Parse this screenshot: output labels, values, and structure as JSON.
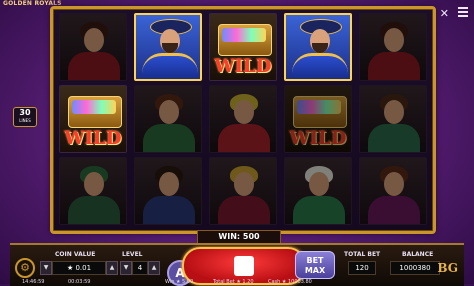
{
  "game": {
    "title": "GOLDEN ROYALS",
    "close_glyph": "✕",
    "lines": {
      "count": "30",
      "label": "LINES"
    }
  },
  "reels": [
    {
      "cells": [
        {
          "type": "queen",
          "dim": true,
          "hair": "#3a1a12",
          "robe": "#8a1a20"
        },
        {
          "type": "wild",
          "dim": false,
          "label": "WILD"
        },
        {
          "type": "jester",
          "dim": true,
          "hair": "#2a6a3a",
          "robe": "#2a5a3a"
        }
      ]
    },
    {
      "cells": [
        {
          "type": "king",
          "dim": false
        },
        {
          "type": "queen",
          "dim": true,
          "hair": "#5a2a18",
          "robe": "#2a6a3a"
        },
        {
          "type": "prince",
          "dim": true,
          "hair": "#2a1a10",
          "robe": "#2a3a7a"
        }
      ]
    },
    {
      "cells": [
        {
          "type": "wild",
          "dim": false,
          "label": "WILD"
        },
        {
          "type": "queen",
          "dim": true,
          "hair": "#c8b030",
          "robe": "#a8222a"
        },
        {
          "type": "queen",
          "dim": true,
          "hair": "#c8a030",
          "robe": "#7a1a30"
        }
      ]
    },
    {
      "cells": [
        {
          "type": "king",
          "dim": false
        },
        {
          "type": "wild",
          "dim": true,
          "label": "WILD"
        },
        {
          "type": "elder",
          "dim": true,
          "hair": "#e8e8e0",
          "robe": "#2a7a4a"
        }
      ]
    },
    {
      "cells": [
        {
          "type": "queen",
          "dim": true,
          "hair": "#3a1a12",
          "robe": "#8a1a20"
        },
        {
          "type": "queen",
          "dim": true,
          "hair": "#4a2a18",
          "robe": "#2a6a4a"
        },
        {
          "type": "queen",
          "dim": true,
          "hair": "#5a2a18",
          "robe": "#6a1a5a"
        }
      ]
    }
  ],
  "win": {
    "label": "WIN:",
    "value": "500"
  },
  "controls": {
    "coin_value": {
      "label": "COIN VALUE",
      "value": "★ 0.01"
    },
    "level": {
      "label": "LEVEL",
      "value": "4"
    },
    "auto_label": "A",
    "bet_max": {
      "line1": "BET",
      "line2": "MAX"
    },
    "total_bet": {
      "label": "TOTAL BET",
      "value": "120"
    },
    "balance": {
      "label": "BALANCE",
      "value": "1000380"
    },
    "settings_glyph": "⚙",
    "brand": "BG"
  },
  "footer": {
    "clock": "14:46:59",
    "session_time": "00:03:59",
    "win": "Win ★ 5.00",
    "total_bet": "Total Bet ★ 1.20",
    "cash": "Cash ★ 10003.80"
  }
}
